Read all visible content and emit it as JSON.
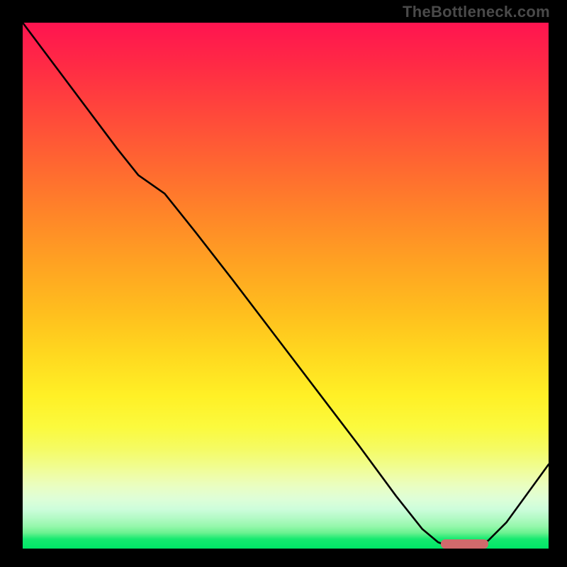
{
  "watermark": "TheBottleneck.com",
  "chart_data": {
    "type": "line",
    "title": "",
    "xlabel": "",
    "ylabel": "",
    "xlim": [
      0,
      100
    ],
    "ylim": [
      0,
      100
    ],
    "grid": false,
    "legend": false,
    "series": [
      {
        "name": "curve",
        "x": [
          0,
          6,
          12,
          18,
          22,
          27,
          33,
          40,
          48,
          56,
          64,
          71,
          76,
          79,
          81.5,
          85.5,
          88.5,
          92,
          96,
          100
        ],
        "values": [
          100,
          92,
          84,
          76,
          71,
          67.5,
          60,
          51,
          40.5,
          30,
          19.5,
          10,
          3.7,
          1.2,
          0.3,
          0.3,
          1.5,
          5,
          10.5,
          16
        ]
      }
    ],
    "annotations": [
      {
        "name": "floor-bar",
        "x_start": 79.5,
        "x_end": 88.5,
        "y": 0
      }
    ],
    "gradient_stops": [
      {
        "p": 0,
        "c": "#ff1450"
      },
      {
        "p": 8,
        "c": "#ff2a45"
      },
      {
        "p": 18,
        "c": "#ff4a3a"
      },
      {
        "p": 28,
        "c": "#ff6a30"
      },
      {
        "p": 37,
        "c": "#ff8728"
      },
      {
        "p": 46,
        "c": "#ffa322"
      },
      {
        "p": 55,
        "c": "#ffbe1e"
      },
      {
        "p": 63,
        "c": "#ffd81f"
      },
      {
        "p": 71,
        "c": "#fff026"
      },
      {
        "p": 77,
        "c": "#fbfa3e"
      },
      {
        "p": 81,
        "c": "#f5fb63"
      },
      {
        "p": 84,
        "c": "#f1fd8a"
      },
      {
        "p": 86.5,
        "c": "#eefdad"
      },
      {
        "p": 88.5,
        "c": "#e8fec5"
      },
      {
        "p": 90.5,
        "c": "#defed7"
      },
      {
        "p": 92.5,
        "c": "#cdfddb"
      },
      {
        "p": 94,
        "c": "#b6fac8"
      },
      {
        "p": 95.8,
        "c": "#94f7ab"
      },
      {
        "p": 97,
        "c": "#6bf290"
      },
      {
        "p": 98.2,
        "c": "#16e96f"
      },
      {
        "p": 100,
        "c": "#00e667"
      }
    ]
  }
}
